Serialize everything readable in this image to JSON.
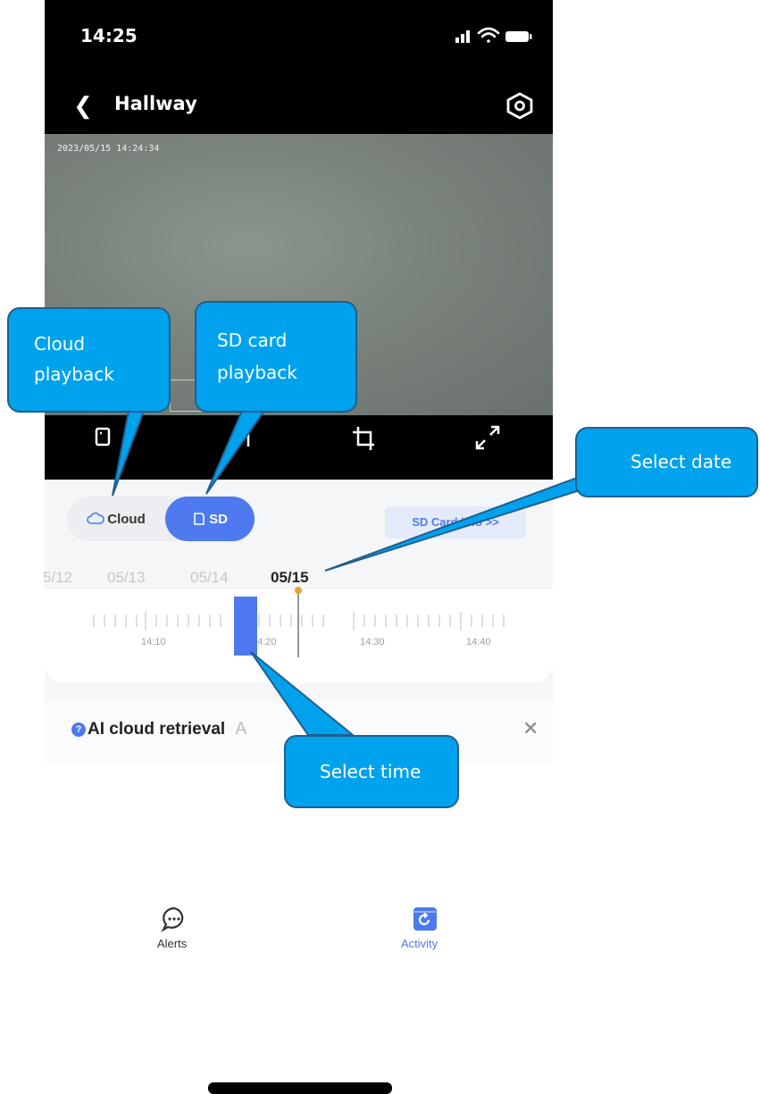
{
  "status_bar": {
    "time": "14:25"
  },
  "nav": {
    "title": "Hallway"
  },
  "video": {
    "timestamp": "2023/05/15 14:24:34"
  },
  "source_toggle": {
    "cloud_label": "Cloud",
    "sd_label": "SD",
    "selected": "SD"
  },
  "sd_card_link": "SD Card info >>",
  "dates": [
    "5/12",
    "05/13",
    "05/14",
    "05/15"
  ],
  "selected_date": "05/15",
  "timeline": {
    "labels": [
      "14:10",
      "14:20",
      "14:30",
      "14:40"
    ]
  },
  "ai_banner": {
    "title": "AI cloud retrieval",
    "suffix": "A"
  },
  "callouts": {
    "cloud": "Cloud playback",
    "sd": "SD card playback",
    "date": "Select date",
    "time": "Select time"
  },
  "bottom_nav": {
    "alerts": "Alerts",
    "activity": "Activity"
  },
  "colors": {
    "accent": "#4e79ef",
    "callout": "#00a2ed",
    "callout_border": "#1f5f8f"
  }
}
